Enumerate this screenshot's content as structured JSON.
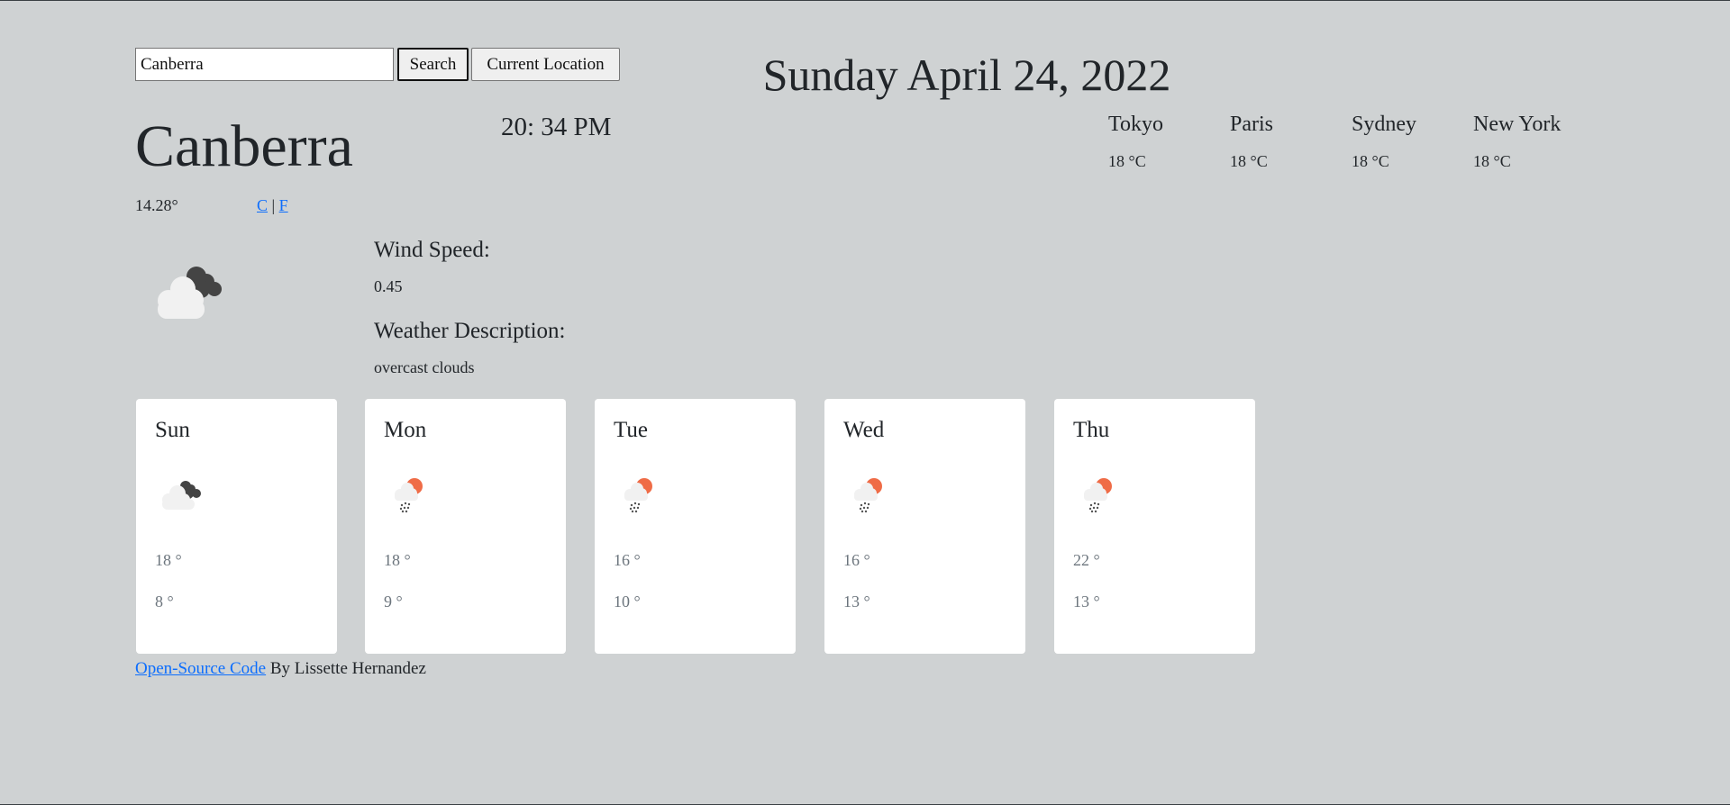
{
  "search": {
    "value": "Canberra",
    "button": "Search",
    "location_button": "Current Location"
  },
  "date": "Sunday April 24, 2022",
  "current": {
    "city": "Canberra",
    "time": "20: 34 PM",
    "temperature": "14.28°",
    "unit_c": "C",
    "unit_sep": "|",
    "unit_f": "F",
    "icon": "overcast-clouds-icon",
    "wind_label": "Wind Speed:",
    "wind_value": "0.45",
    "desc_label": "Weather Description:",
    "desc_value": "overcast clouds"
  },
  "cities": [
    {
      "name": "Tokyo",
      "temp": "18 °C"
    },
    {
      "name": "Paris",
      "temp": "18 °C"
    },
    {
      "name": "Sydney",
      "temp": "18 °C"
    },
    {
      "name": "New York",
      "temp": "18 °C"
    }
  ],
  "forecast": [
    {
      "day": "Sun",
      "icon": "overcast-clouds-icon",
      "max": "18 °",
      "min": "8 °"
    },
    {
      "day": "Mon",
      "icon": "sun-rain-icon",
      "max": "18 °",
      "min": "9 °"
    },
    {
      "day": "Tue",
      "icon": "sun-rain-icon",
      "max": "16 °",
      "min": "10 °"
    },
    {
      "day": "Wed",
      "icon": "sun-rain-icon",
      "max": "16 °",
      "min": "13 °"
    },
    {
      "day": "Thu",
      "icon": "sun-rain-icon",
      "max": "22 °",
      "min": "13 °"
    }
  ],
  "footer": {
    "link": "Open-Source Code",
    "text": " By Lissette Hernandez"
  },
  "colors": {
    "background": "#cfd2d3",
    "link": "#0d6efd",
    "sun": "#ef6c47",
    "dark_cloud": "#444444",
    "light_cloud": "#f1f1f1"
  }
}
